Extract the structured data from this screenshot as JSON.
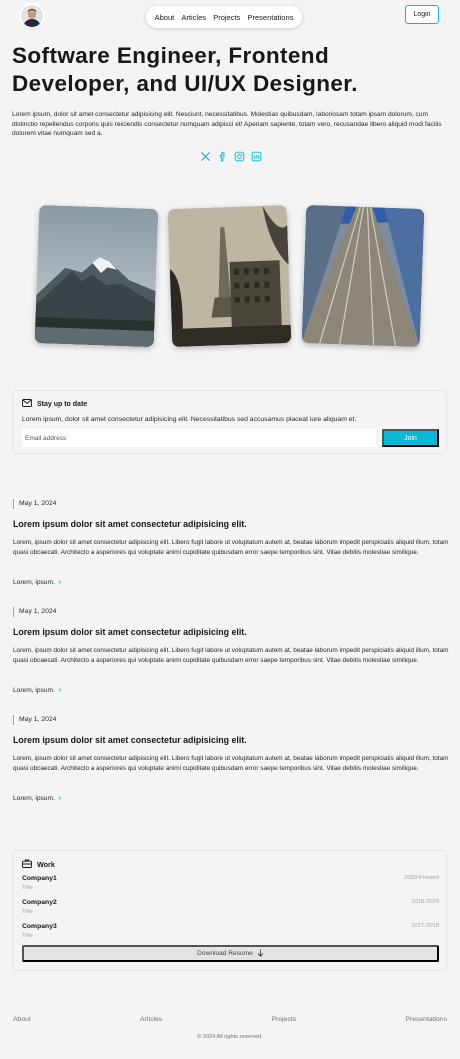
{
  "header": {
    "nav": [
      "About",
      "Articles",
      "Projects",
      "Presentations"
    ],
    "login_label": "Login"
  },
  "hero": {
    "title": "Software Engineer, Frontend Developer, and UI/UX Designer.",
    "text": "Lorem ipsum, dolor sit amet consectetur adipisicing elit. Nesciunt, necessitatibus. Molestias quibusdam, laboriosam totam ipsam dolorum, cum distinctio repellendus corporis quis reiciendis consectetur numquam adipisci et! Aperiam sapiente, totam vero, recusandae libero aliquid modi facilis dolorem vitae numquam sed a.",
    "socials": [
      "x-icon",
      "facebook-icon",
      "instagram-icon",
      "linkedin-icon"
    ]
  },
  "newsletter": {
    "title": "Stay up to date",
    "text": "Lorem ipsum, dolor sit amet consectetur adipisicing elit. Necessitatibus sed accusamus placeat iure aliquam et.",
    "placeholder": "Email address",
    "button": "Join"
  },
  "articles": [
    {
      "date": "May 1, 2024",
      "title": "Lorem ipsum dolor sit amet consectetur adipisicing elit.",
      "body": "Lorem, ipsum dolor sit amet consectetur adipisicing elit. Libero fugit labore ut voluptatum autem at, beatae laborum impedit perspiciatis aliquid illum, totam quasi obcaecati. Architecto a asperiores qui voluptate animi cupiditate quibusdam error saepe temporibus sint. Vitae debitis molestiae similique.",
      "more": "Lorem, ipsum."
    },
    {
      "date": "May 1, 2024",
      "title": "Lorem ipsum dolor sit amet consectetur adipisicing elit.",
      "body": "Lorem, ipsum dolor sit amet consectetur adipisicing elit. Libero fugit labore ut voluptatum autem at, beatae laborum impedit perspiciatis aliquid illum, totam quasi obcaecati. Architecto a asperiores qui voluptate animi cupiditate quibusdam error saepe temporibus sint. Vitae debitis molestiae similique.",
      "more": "Lorem, ipsum."
    },
    {
      "date": "May 1, 2024",
      "title": "Lorem ipsum dolor sit amet consectetur adipisicing elit.",
      "body": "Lorem, ipsum dolor sit amet consectetur adipisicing elit. Libero fugit labore ut voluptatum autem at, beatae laborum impedit perspiciatis aliquid illum, totam quasi obcaecati. Architecto a asperiores qui voluptate animi cupiditate quibusdam error saepe temporibus sint. Vitae debitis molestiae similique.",
      "more": "Lorem, ipsum."
    }
  ],
  "work": {
    "title": "Work",
    "jobs": [
      {
        "company": "Company1",
        "title": "Title",
        "years": "2020-Present"
      },
      {
        "company": "Company2",
        "title": "Title",
        "years": "2018-2020"
      },
      {
        "company": "Company3",
        "title": "Title",
        "years": "2017-2018"
      }
    ],
    "download": "Download Resume"
  },
  "footer": {
    "links": [
      "About",
      "Articles",
      "Projects",
      "Presentations"
    ],
    "copyright": "© 2024 All rights reserved."
  },
  "colors": {
    "accent": "#0bb6d6",
    "background": "#f4f4f5"
  }
}
